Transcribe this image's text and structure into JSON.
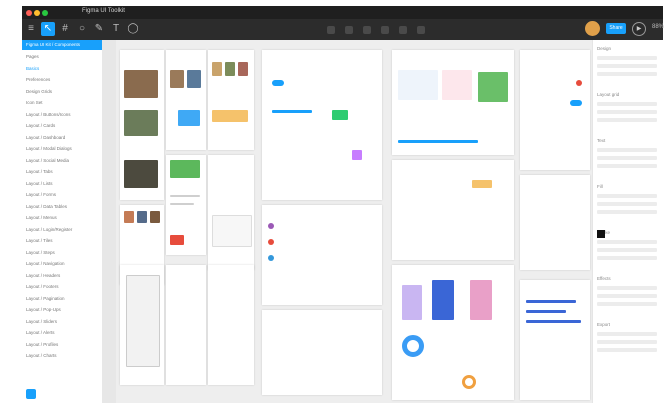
{
  "window": {
    "title": "Figma UI Toolkit",
    "traffic_colors": [
      "#ff5f57",
      "#febc2e",
      "#28c840"
    ]
  },
  "toolbar": {
    "tools": [
      "menu",
      "move",
      "frame",
      "shape",
      "pen",
      "text",
      "comment"
    ],
    "active_tool": "move",
    "share_label": "Share",
    "zoom": "88%"
  },
  "left_panel": {
    "selected_page": "Figma UI Kit / Components",
    "layers": [
      "Pages",
      "Basics",
      "Preferences",
      "Design Grids",
      "Icon Set",
      "Layout / Buttons/Icons",
      "Layout / Cards",
      "Layout / Dashboard",
      "Layout / Modal Dialogs",
      "Layout / Social Media",
      "Layout / Tabs",
      "Layout / Lists",
      "Layout / Forms",
      "Layout / Data Tables",
      "Layout / Menus",
      "Layout / Login/Register",
      "Layout / Tiles",
      "Layout / Steps",
      "Layout / Navigation",
      "Layout / Headers",
      "Layout / Footers",
      "Layout / Pagination",
      "Layout / Pop-Ups",
      "Layout / Sliders",
      "Layout / Alerts",
      "Layout / Profiles",
      "Layout / Charts"
    ]
  },
  "right_panel": {
    "sections": [
      "Design",
      "Layout grid",
      "Text",
      "Fill",
      "Stroke",
      "Effects",
      "Export"
    ]
  },
  "colors": {
    "accent": "#18a0fb",
    "toolbar": "#2c2c2c",
    "canvas": "#eeeeee"
  }
}
